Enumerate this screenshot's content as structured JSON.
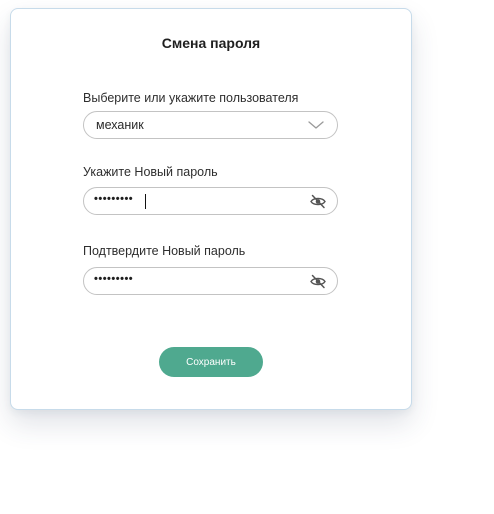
{
  "dialog": {
    "title": "Смена пароля",
    "user_label": "Выберите или укажите пользователя",
    "user_value": "механик",
    "new_password_label": "Укажите Новый пароль",
    "new_password_value": "•••••••••",
    "confirm_password_label": "Подтвердите Новый пароль",
    "confirm_password_value": "•••••••••",
    "save_label": "Сохранить"
  },
  "icons": {
    "user_select": "chevron-down-icon",
    "new_password_toggle": "eye-off-icon",
    "confirm_password_toggle": "eye-off-icon"
  },
  "colors": {
    "accent": "#4fa98f",
    "card_border": "#c7dbea",
    "field_border": "#c3c3c3"
  }
}
